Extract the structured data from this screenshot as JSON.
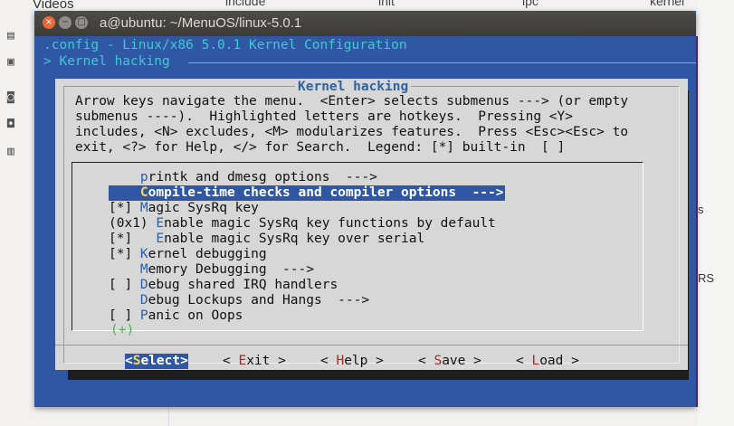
{
  "background": {
    "sidebar_item": "Videos",
    "top_labels": [
      "include",
      "init",
      "ipc",
      "kernel"
    ],
    "right_labels": [
      "s",
      "RS"
    ]
  },
  "window": {
    "title": "a@ubuntu: ~/MenuOS/linux-5.0.1",
    "close_glyph": "×",
    "min_glyph": "−",
    "max_glyph": "□"
  },
  "header": {
    "config_line": ".config - Linux/x86 5.0.1 Kernel Configuration",
    "breadcrumb": "> Kernel hacking"
  },
  "dialog": {
    "title": "Kernel hacking",
    "help_lines": [
      "Arrow keys navigate the menu.  <Enter> selects submenus ---> (or empty",
      "submenus ----).  Highlighted letters are hotkeys.  Pressing <Y>",
      "includes, <N> excludes, <M> modularizes features.  Press <Esc><Esc> to",
      "exit, <?> for Help, </> for Search.  Legend: [*] built-in  [ ]"
    ],
    "menu_items": [
      {
        "prefix": "    ",
        "hotkey": "p",
        "text": "rintk and dmesg options  --->"
      },
      {
        "prefix": "    ",
        "hotkey": "C",
        "text": "ompile-time checks and compiler options  --->",
        "selected": true
      },
      {
        "prefix": "[*] ",
        "hotkey": "M",
        "text": "agic SysRq key"
      },
      {
        "prefix": "(0x1) ",
        "hotkey": "E",
        "text": "nable magic SysRq key functions by default"
      },
      {
        "prefix": "[*]   ",
        "hotkey": "E",
        "text": "nable magic SysRq key over serial"
      },
      {
        "prefix": "[*] ",
        "hotkey": "K",
        "text": "ernel debugging"
      },
      {
        "prefix": "    ",
        "hotkey": "M",
        "text": "emory Debugging  --->",
        "hotkey_pos": 1
      },
      {
        "prefix": "[ ] ",
        "hotkey": "D",
        "text": "ebug shared IRQ handlers"
      },
      {
        "prefix": "    ",
        "hotkey": "D",
        "text": "ebug Lockups and Hangs  --->"
      },
      {
        "prefix": "[ ] ",
        "hotkey": "P",
        "text": "anic on Oops"
      }
    ],
    "more_indicator": "(+)",
    "buttons": [
      {
        "left": "<",
        "hotkey": "S",
        "rest": "elect",
        "right": ">",
        "selected": true
      },
      {
        "left": "< ",
        "hotkey": "E",
        "rest": "xit",
        "right": " >"
      },
      {
        "left": "< ",
        "hotkey": "H",
        "rest": "elp",
        "right": " >"
      },
      {
        "left": "< ",
        "hotkey": "S",
        "rest": "ave",
        "right": " >"
      },
      {
        "left": "< ",
        "hotkey": "L",
        "rest": "oad",
        "right": " >"
      }
    ]
  },
  "colors": {
    "terminal_bg": "#2f57a3",
    "dialog_bg": "#d7d7d7",
    "header_text": "#41c9d4",
    "hotkey_menu": "#2b5da8",
    "hotkey_button": "#b52020",
    "selected_hotkey": "#ffd54f"
  }
}
